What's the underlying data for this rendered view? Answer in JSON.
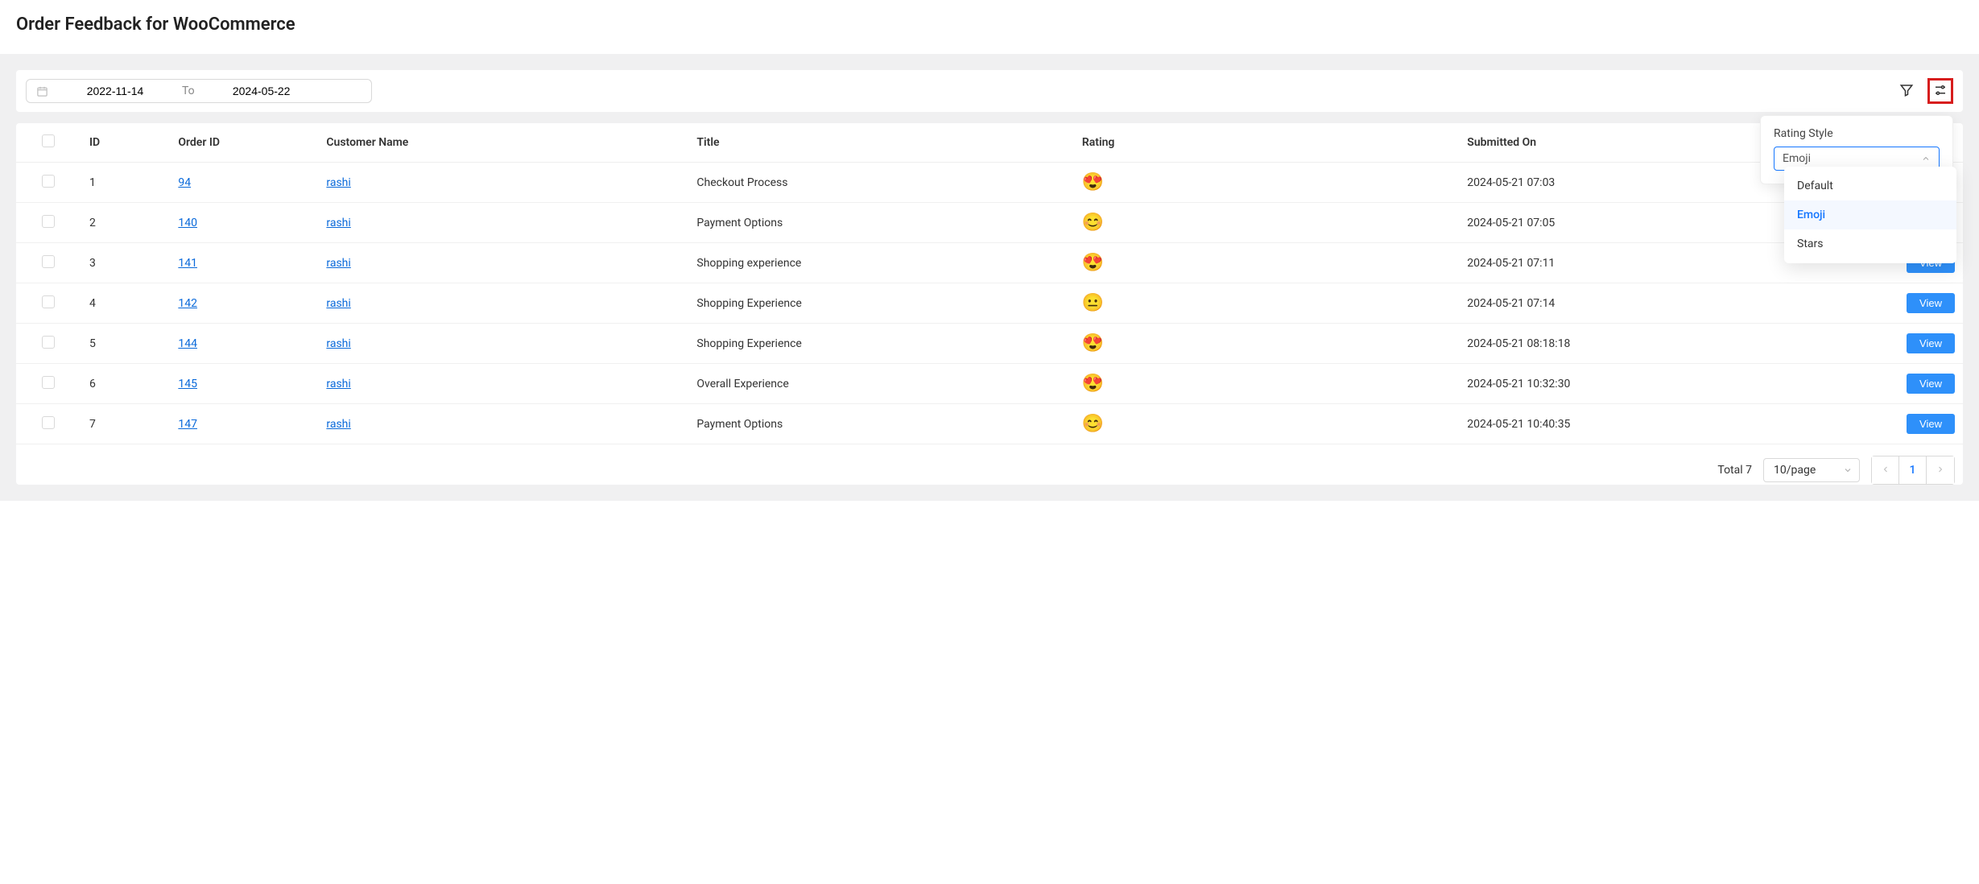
{
  "header": {
    "title": "Order Feedback for WooCommerce"
  },
  "filters": {
    "date_from": "2022-11-14",
    "date_to": "2024-05-22",
    "to_label": "To"
  },
  "settings_popover": {
    "label": "Rating Style",
    "selected": "Emoji",
    "options": [
      {
        "label": "Default",
        "active": false
      },
      {
        "label": "Emoji",
        "active": true
      },
      {
        "label": "Stars",
        "active": false
      }
    ]
  },
  "table": {
    "columns": {
      "id": "ID",
      "order_id": "Order ID",
      "customer": "Customer Name",
      "title": "Title",
      "rating": "Rating",
      "submitted": "Submitted On"
    },
    "action_label": "View",
    "rows": [
      {
        "idx": "1",
        "order_id": "94",
        "customer": "rashi",
        "title": "Checkout Process",
        "rating": "😍",
        "submitted": "2024-05-21 07:03"
      },
      {
        "idx": "2",
        "order_id": "140",
        "customer": "rashi",
        "title": "Payment Options",
        "rating": "😊",
        "submitted": "2024-05-21 07:05"
      },
      {
        "idx": "3",
        "order_id": "141",
        "customer": "rashi",
        "title": "Shopping experience",
        "rating": "😍",
        "submitted": "2024-05-21 07:11"
      },
      {
        "idx": "4",
        "order_id": "142",
        "customer": "rashi",
        "title": "Shopping Experience",
        "rating": "😐",
        "submitted": "2024-05-21 07:14"
      },
      {
        "idx": "5",
        "order_id": "144",
        "customer": "rashi",
        "title": "Shopping Experience",
        "rating": "😍",
        "submitted": "2024-05-21 08:18:18"
      },
      {
        "idx": "6",
        "order_id": "145",
        "customer": "rashi",
        "title": "Overall Experience",
        "rating": "😍",
        "submitted": "2024-05-21 10:32:30"
      },
      {
        "idx": "7",
        "order_id": "147",
        "customer": "rashi",
        "title": "Payment Options",
        "rating": "😊",
        "submitted": "2024-05-21 10:40:35"
      }
    ]
  },
  "pagination": {
    "total_label": "Total 7",
    "per_page": "10/page",
    "current": "1"
  }
}
